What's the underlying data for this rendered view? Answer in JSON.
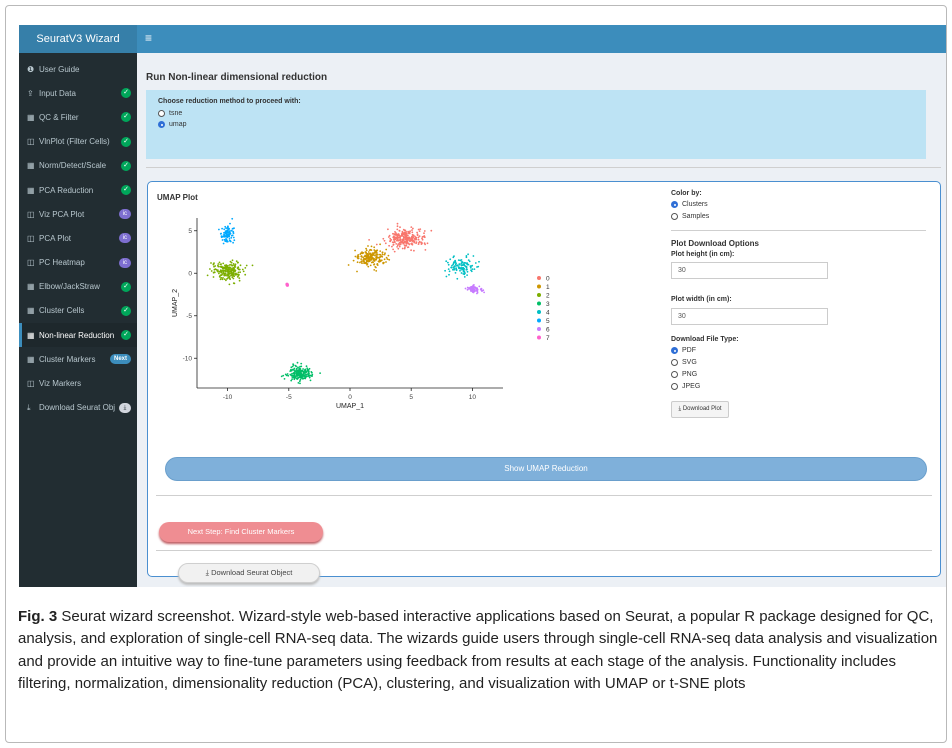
{
  "app": {
    "title": "SeuratV3 Wizard",
    "menu_icon": "hamburger-icon"
  },
  "sidebar": {
    "items": [
      {
        "label": "User Guide",
        "icon": "info-icon",
        "badge": ""
      },
      {
        "label": "Input Data",
        "icon": "upload-icon",
        "badge": "check"
      },
      {
        "label": "QC & Filter",
        "icon": "table-icon",
        "badge": "check"
      },
      {
        "label": "VlnPlot (Filter Cells)",
        "icon": "chart-icon",
        "badge": "check"
      },
      {
        "label": "Norm/Detect/Scale",
        "icon": "table-icon",
        "badge": "check"
      },
      {
        "label": "PCA Reduction",
        "icon": "table-icon",
        "badge": "check"
      },
      {
        "label": "Viz PCA Plot",
        "icon": "chart-icon",
        "badge": "ic"
      },
      {
        "label": "PCA Plot",
        "icon": "chart-icon",
        "badge": "ic"
      },
      {
        "label": "PC Heatmap",
        "icon": "chart-icon",
        "badge": "ic"
      },
      {
        "label": "Elbow/JackStraw",
        "icon": "table-icon",
        "badge": "check"
      },
      {
        "label": "Cluster Cells",
        "icon": "table-icon",
        "badge": "check"
      },
      {
        "label": "Non-linear Reduction",
        "icon": "table-icon",
        "badge": "check"
      },
      {
        "label": "Cluster Markers",
        "icon": "table-icon",
        "badge": "Next"
      },
      {
        "label": "Viz Markers",
        "icon": "chart-icon",
        "badge": ""
      },
      {
        "label": "Download Seurat Obj",
        "icon": "download-icon",
        "badge": "dl"
      }
    ],
    "active_index": 11,
    "badge_ic_text": "ic"
  },
  "main": {
    "title": "Run Non-linear dimensional reduction",
    "method": {
      "label": "Choose reduction method to proceed with:",
      "options": [
        "tsne",
        "umap"
      ],
      "selected": "umap"
    },
    "plot_title": "UMAP Plot",
    "color_by": {
      "label": "Color by:",
      "options": [
        "Clusters",
        "Samples"
      ],
      "selected": "Clusters"
    },
    "download": {
      "heading": "Plot Download Options",
      "height_label": "Plot height (in cm):",
      "height_value": "30",
      "width_label": "Plot width (in cm):",
      "width_value": "30",
      "type_label": "Download File Type:",
      "types": [
        "PDF",
        "SVG",
        "PNG",
        "JPEG"
      ],
      "selected_type": "PDF",
      "button": "Download Plot"
    },
    "show_button": "Show UMAP Reduction",
    "next_button": "Next Step: Find Cluster Markers",
    "download_object_button": "Download Seurat Object"
  },
  "chart_data": {
    "type": "scatter",
    "xlabel": "UMAP_1",
    "ylabel": "UMAP_2",
    "xticks": [
      -10,
      -5,
      0,
      5,
      10
    ],
    "yticks": [
      5,
      0,
      -5,
      -10
    ],
    "xlim": [
      -12.5,
      12.5
    ],
    "ylim": [
      -13.5,
      6.5
    ],
    "legend_position": "right",
    "series": [
      {
        "name": "0",
        "color": "#f8766d",
        "cx": 4.5,
        "cy": 4.0,
        "sx": 1.4,
        "sy": 1.1,
        "n": 260
      },
      {
        "name": "1",
        "color": "#cd9600",
        "cx": 1.8,
        "cy": 1.8,
        "sx": 1.2,
        "sy": 1.0,
        "n": 200
      },
      {
        "name": "2",
        "color": "#7cae00",
        "cx": -10.0,
        "cy": 0.2,
        "sx": 1.2,
        "sy": 1.0,
        "n": 210
      },
      {
        "name": "3",
        "color": "#00be67",
        "cx": -4.0,
        "cy": -11.8,
        "sx": 0.9,
        "sy": 0.8,
        "n": 190
      },
      {
        "name": "4",
        "color": "#00bfc4",
        "cx": 9.0,
        "cy": 0.8,
        "sx": 1.0,
        "sy": 1.0,
        "n": 120
      },
      {
        "name": "5",
        "color": "#00a9ff",
        "cx": -10.0,
        "cy": 4.5,
        "sx": 0.5,
        "sy": 0.9,
        "n": 100
      },
      {
        "name": "6",
        "color": "#c77cff",
        "cx": 10.2,
        "cy": -1.9,
        "sx": 0.6,
        "sy": 0.4,
        "n": 70
      },
      {
        "name": "7",
        "color": "#ff61cc",
        "cx": -5.2,
        "cy": -1.4,
        "sx": 0.1,
        "sy": 0.1,
        "n": 3
      }
    ]
  },
  "caption": {
    "figure_label": "Fig. 3",
    "text": "Seurat wizard screenshot. Wizard-style web-based interactive applications based on Seurat, a popular R package designed for QC, analysis, and exploration of single-cell RNA-seq data. The wizards guide users through single-cell RNA-seq data analysis and visualization and provide an intuitive way to fine-tune parameters using feedback from results at each stage of the analysis. Functionality includes filtering, normalization, dimensionality reduction (PCA), clustering, and visualization with UMAP or t-SNE plots"
  }
}
